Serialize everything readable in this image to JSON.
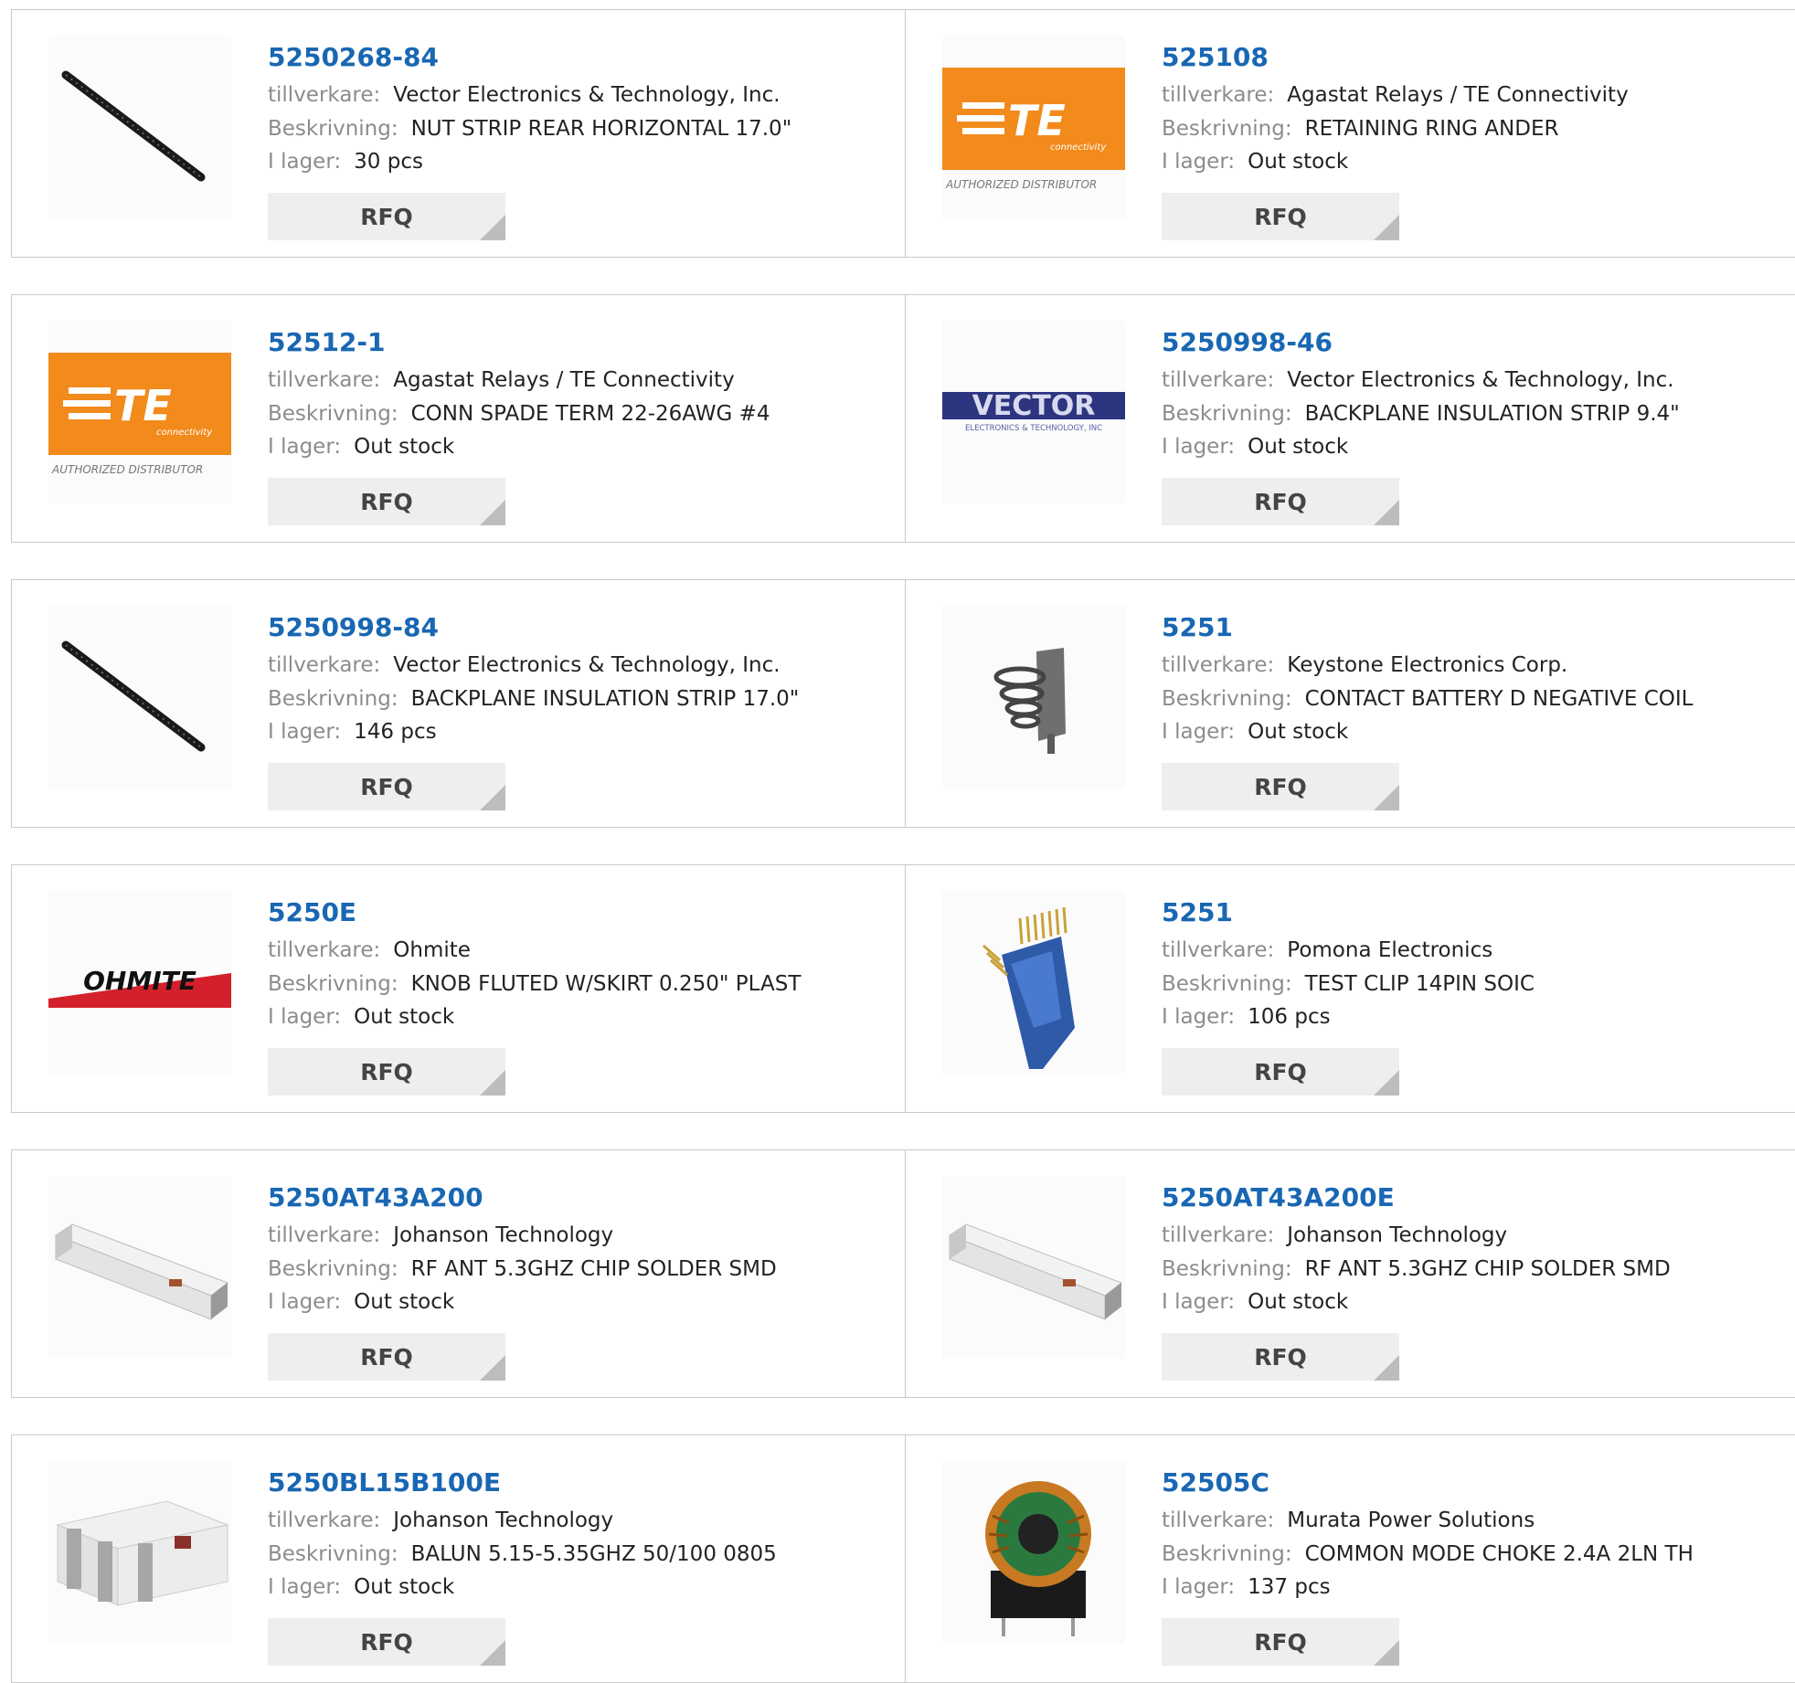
{
  "labels": {
    "manufacturer": "tillverkare:",
    "description": "Beskrivning:",
    "stock": "I lager:",
    "rfq": "RFQ"
  },
  "logo_text": {
    "te": "TE",
    "te_sub": "connectivity",
    "te_auth": "AUTHORIZED DISTRIBUTOR",
    "vector": "VECTOR",
    "vector_sub": "ELECTRONICS & TECHNOLOGY, INC",
    "ohmite": "OHMITE"
  },
  "products": [
    {
      "part": "5250268-84",
      "manufacturer": "Vector Electronics & Technology, Inc.",
      "description": "NUT STRIP REAR HORIZONTAL 17.0\"",
      "stock": "30 pcs",
      "image": "black-strip-image"
    },
    {
      "part": "525108",
      "manufacturer": "Agastat Relays / TE Connectivity",
      "description": "RETAINING RING ANDER",
      "stock": "Out stock",
      "image": "te-logo"
    },
    {
      "part": "52512-1",
      "manufacturer": "Agastat Relays / TE Connectivity",
      "description": "CONN SPADE TERM 22-26AWG #4",
      "stock": "Out stock",
      "image": "te-logo"
    },
    {
      "part": "5250998-46",
      "manufacturer": "Vector Electronics & Technology, Inc.",
      "description": "BACKPLANE INSULATION STRIP 9.4\"",
      "stock": "Out stock",
      "image": "vector-logo"
    },
    {
      "part": "5250998-84",
      "manufacturer": "Vector Electronics & Technology, Inc.",
      "description": "BACKPLANE INSULATION STRIP 17.0\"",
      "stock": "146 pcs",
      "image": "black-strip-image"
    },
    {
      "part": "5251",
      "manufacturer": "Keystone Electronics Corp.",
      "description": "CONTACT BATTERY D NEGATIVE COIL",
      "stock": "Out stock",
      "image": "battery-spring-image"
    },
    {
      "part": "5250E",
      "manufacturer": "Ohmite",
      "description": "KNOB FLUTED W/SKIRT 0.250\" PLAST",
      "stock": "Out stock",
      "image": "ohmite-logo"
    },
    {
      "part": "5251",
      "manufacturer": "Pomona Electronics",
      "description": "TEST CLIP 14PIN SOIC",
      "stock": "106 pcs",
      "image": "test-clip-image"
    },
    {
      "part": "5250AT43A200",
      "manufacturer": "Johanson Technology",
      "description": "RF ANT 5.3GHZ CHIP SOLDER SMD",
      "stock": "Out stock",
      "image": "chip-antenna-image"
    },
    {
      "part": "5250AT43A200E",
      "manufacturer": "Johanson Technology",
      "description": "RF ANT 5.3GHZ CHIP SOLDER SMD",
      "stock": "Out stock",
      "image": "chip-antenna-image"
    },
    {
      "part": "5250BL15B100E",
      "manufacturer": "Johanson Technology",
      "description": "BALUN 5.15-5.35GHZ 50/100 0805",
      "stock": "Out stock",
      "image": "balun-chip-image"
    },
    {
      "part": "52505C",
      "manufacturer": "Murata Power Solutions",
      "description": "COMMON MODE CHOKE 2.4A 2LN TH",
      "stock": "137 pcs",
      "image": "choke-image"
    }
  ]
}
